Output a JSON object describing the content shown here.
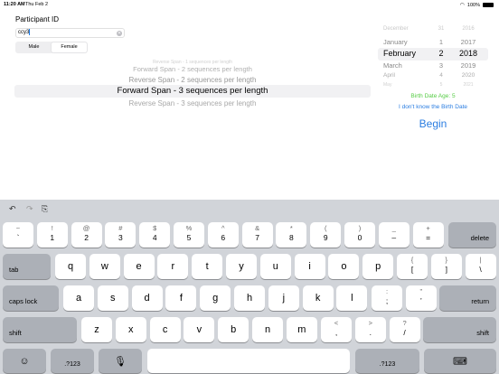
{
  "status": {
    "time": "11:20 AM",
    "date": "Thu Feb 2",
    "battery": "100%"
  },
  "participant": {
    "label": "Participant ID",
    "value": "ccy3",
    "gender": {
      "options": [
        "Male",
        "Female"
      ],
      "selected": "Female"
    }
  },
  "span_picker": {
    "rows": [
      "Reverse Span - 1 sequences per length",
      "Forward Span - 2 sequences per length",
      "Reverse Span - 2 sequences per length",
      "Forward Span - 3 sequences per length",
      "Reverse Span - 3 sequences per length",
      ""
    ],
    "selected": "Forward Span - 3 sequences per length"
  },
  "date_picker": {
    "rows": [
      {
        "month": "December",
        "day": "31",
        "year": "2016"
      },
      {
        "month": "January",
        "day": "1",
        "year": "2017"
      },
      {
        "month": "February",
        "day": "2",
        "year": "2018"
      },
      {
        "month": "March",
        "day": "3",
        "year": "2019"
      },
      {
        "month": "April",
        "day": "4",
        "year": "2020"
      },
      {
        "month": "May",
        "day": "5",
        "year": "2021"
      }
    ],
    "selected_index": 2
  },
  "birth_age": "Birth Date Age: 5",
  "dont_know": "I don't know the Birth Date",
  "begin": "Begin",
  "keyboard": {
    "row1": [
      {
        "t": "~",
        "b": "`"
      },
      {
        "t": "!",
        "b": "1"
      },
      {
        "t": "@",
        "b": "2"
      },
      {
        "t": "#",
        "b": "3"
      },
      {
        "t": "$",
        "b": "4"
      },
      {
        "t": "%",
        "b": "5"
      },
      {
        "t": "^",
        "b": "6"
      },
      {
        "t": "&",
        "b": "7"
      },
      {
        "t": "*",
        "b": "8"
      },
      {
        "t": "(",
        "b": "9"
      },
      {
        "t": ")",
        "b": "0"
      },
      {
        "t": "_",
        "b": "–"
      },
      {
        "t": "+",
        "b": "="
      }
    ],
    "delete": "delete",
    "tab": "tab",
    "row2": [
      "q",
      "w",
      "e",
      "r",
      "t",
      "y",
      "u",
      "i",
      "o",
      "p"
    ],
    "row2_extra": [
      {
        "t": "{",
        "b": "["
      },
      {
        "t": "}",
        "b": "]"
      },
      {
        "t": "|",
        "b": "\\"
      }
    ],
    "caps": "caps lock",
    "row3": [
      "a",
      "s",
      "d",
      "f",
      "g",
      "h",
      "j",
      "k",
      "l"
    ],
    "row3_extra": [
      {
        "t": ":",
        "b": ";"
      },
      {
        "t": "”",
        "b": "’"
      }
    ],
    "return": "return",
    "shift": "shift",
    "row4": [
      "z",
      "x",
      "c",
      "v",
      "b",
      "n",
      "m"
    ],
    "row4_extra": [
      {
        "t": "<",
        "b": ","
      },
      {
        "t": ">",
        "b": "."
      },
      {
        "t": "?",
        "b": "/"
      }
    ],
    "num": ".?123"
  }
}
